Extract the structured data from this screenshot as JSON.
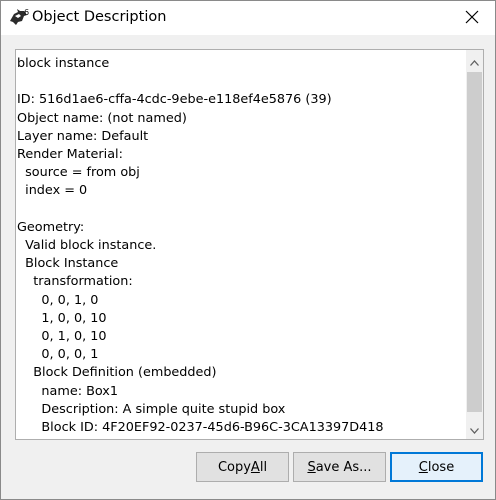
{
  "window": {
    "title": "Object Description",
    "app_icon": "rhino-icon",
    "app_icon_badge": "6"
  },
  "content": {
    "lines": [
      "block instance",
      "",
      "ID: 516d1ae6-cffa-4cdc-9ebe-e118ef4e5876 (39)",
      "Object name: (not named)",
      "Layer name: Default",
      "Render Material:",
      "  source = from obj",
      "  index = 0",
      "",
      "Geometry:",
      "  Valid block instance.",
      "  Block Instance",
      "    transformation:",
      "      0, 0, 1, 0",
      "      1, 0, 0, 10",
      "      0, 1, 0, 10",
      "      0, 0, 0, 1",
      "    Block Definition (embedded)",
      "      name: Box1",
      "      Description: A simple quite stupid box",
      "      Block ID: 4F20EF92-0237-45d6-B96C-3CA13397D418"
    ]
  },
  "buttons": {
    "copy_all": {
      "pre": "Copy ",
      "acc": "A",
      "post": "ll"
    },
    "save_as": {
      "pre": "",
      "acc": "S",
      "post": "ave As..."
    },
    "close": {
      "pre": "",
      "acc": "C",
      "post": "lose"
    }
  },
  "icons": {
    "close": "close-icon",
    "scroll_up": "chevron-up-icon",
    "scroll_down": "chevron-down-icon"
  }
}
